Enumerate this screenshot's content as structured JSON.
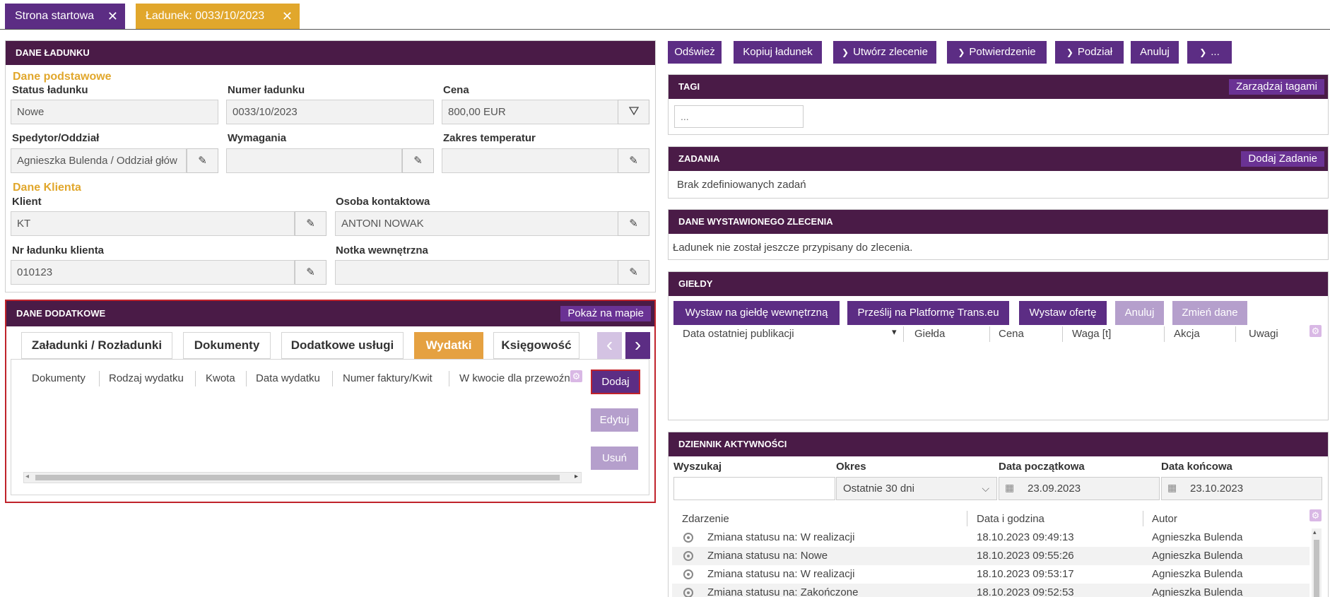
{
  "tabs": [
    {
      "label": "Strona startowa",
      "close": "✕"
    },
    {
      "label": "Ładunek: 0033/10/2023",
      "close": "✕"
    }
  ],
  "load": {
    "title": "DANE ŁADUNKU",
    "basic_section": "Dane podstawowe",
    "status_label": "Status ładunku",
    "status_value": "Nowe",
    "number_label": "Numer ładunku",
    "number_value": "0033/10/2023",
    "price_label": "Cena",
    "price_value": "800,00 EUR",
    "forwarder_label": "Spedytor/Oddział",
    "forwarder_value": "Agnieszka Bulenda / Oddział głów",
    "requirements_label": "Wymagania",
    "requirements_value": "",
    "temp_label": "Zakres temperatur",
    "temp_value": "",
    "client_section": "Dane Klienta",
    "client_label": "Klient",
    "client_value": "KT",
    "contact_label": "Osoba kontaktowa",
    "contact_value": "ANTONI NOWAK",
    "client_no_label": "Nr ładunku klienta",
    "client_no_value": "010123",
    "note_label": "Notka wewnętrzna",
    "note_value": ""
  },
  "extra": {
    "title": "DANE DODATKOWE",
    "map_button": "Pokaż na mapie",
    "tabs": [
      "Załadunki / Rozładunki",
      "Dokumenty",
      "Dodatkowe usługi",
      "Wydatki",
      "Księgowość"
    ],
    "active_tab": "Wydatki",
    "prev": "‹",
    "next": "›",
    "columns": [
      "Dokumenty",
      "Rodzaj wydatku",
      "Kwota",
      "Data wydatku",
      "Numer faktury/Kwit",
      "W kwocie dla przewoźni"
    ],
    "add": "Dodaj",
    "edit": "Edytuj",
    "delete": "Usuń"
  },
  "toolbar": {
    "refresh": "Odśwież",
    "copy": "Kopiuj ładunek",
    "create_order": "Utwórz zlecenie",
    "confirm": "Potwierdzenie",
    "split": "Podział",
    "cancel": "Anuluj",
    "more": "..."
  },
  "tags": {
    "title": "TAGI",
    "manage": "Zarządzaj tagami",
    "value": "..."
  },
  "tasks": {
    "title": "ZADANIA",
    "add": "Dodaj Zadanie",
    "empty": "Brak zdefiniowanych zadań"
  },
  "order": {
    "title": "DANE WYSTAWIONEGO ZLECENIA",
    "text": "Ładunek nie został jeszcze przypisany do zlecenia."
  },
  "exchanges": {
    "title": "GIEŁDY",
    "btn_internal": "Wystaw na giełdę wewnętrzną",
    "btn_transeu": "Prześlij na Platformę Trans.eu",
    "btn_offer": "Wystaw ofertę",
    "btn_cancel": "Anuluj",
    "btn_change": "Zmień dane",
    "columns": [
      "Data ostatniej publikacji",
      "Giełda",
      "Cena",
      "Waga [t]",
      "Akcja",
      "Uwagi"
    ]
  },
  "activity": {
    "title": "DZIENNIK AKTYWNOŚCI",
    "search_label": "Wyszukaj",
    "search_value": "",
    "period_label": "Okres",
    "period_value": "Ostatnie 30 dni",
    "start_label": "Data początkowa",
    "start_value": "23.09.2023",
    "end_label": "Data końcowa",
    "end_value": "23.10.2023",
    "columns": [
      "Zdarzenie",
      "Data i godzina",
      "Autor"
    ],
    "rows": [
      {
        "event": "Zmiana statusu na: W realizacji",
        "date": "18.10.2023 09:49:13",
        "author": "Agnieszka Bulenda"
      },
      {
        "event": "Zmiana statusu na: Nowe",
        "date": "18.10.2023 09:55:26",
        "author": "Agnieszka Bulenda"
      },
      {
        "event": "Zmiana statusu na: W realizacji",
        "date": "18.10.2023 09:53:17",
        "author": "Agnieszka Bulenda"
      },
      {
        "event": "Zmiana statusu na: Zakończone",
        "date": "18.10.2023 09:52:53",
        "author": "Agnieszka Bulenda"
      }
    ]
  },
  "colors": {
    "brand": "#4a1b47",
    "button": "#5c2d84",
    "accent": "#e1a72c",
    "highlight": "#c0232b"
  },
  "icons": {
    "edit": "edit-icon",
    "filter": "filter-icon",
    "calendar": "calendar-icon",
    "settings": "gear-icon"
  }
}
